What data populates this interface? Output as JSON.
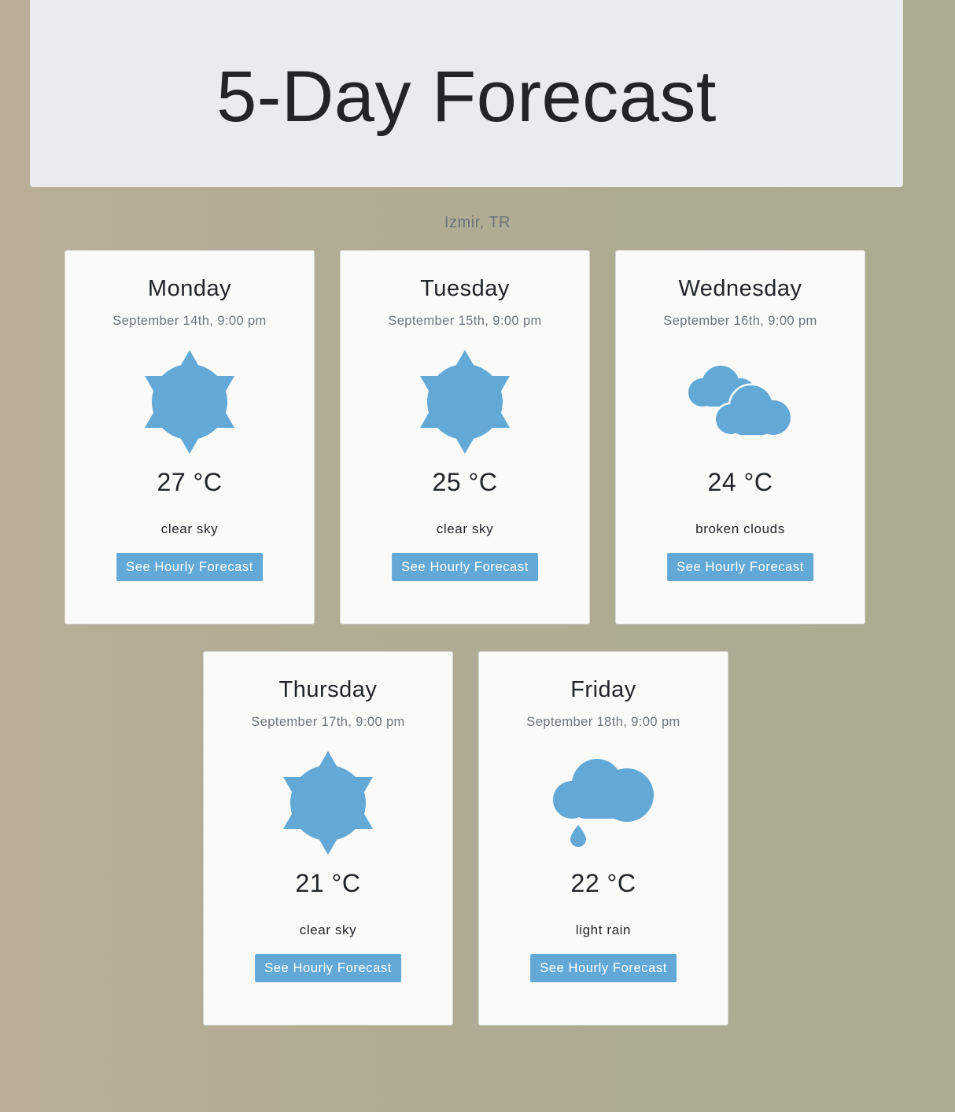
{
  "header": {
    "title": "5-Day Forecast"
  },
  "location": "Izmir, TR",
  "colors": {
    "accent": "#63a9d7",
    "jumbotron_bg": "#e9ebef",
    "card_bg": "#fafaf8"
  },
  "days": [
    {
      "day": "Monday",
      "date": "September 14th, 9:00 pm",
      "icon": "sun-icon",
      "temp": "27 °C",
      "description": "clear sky",
      "button_label": "See Hourly Forecast"
    },
    {
      "day": "Tuesday",
      "date": "September 15th, 9:00 pm",
      "icon": "sun-icon",
      "temp": "25 °C",
      "description": "clear sky",
      "button_label": "See Hourly Forecast"
    },
    {
      "day": "Wednesday",
      "date": "September 16th, 9:00 pm",
      "icon": "cloudy-icon",
      "temp": "24 °C",
      "description": "broken clouds",
      "button_label": "See Hourly Forecast"
    },
    {
      "day": "Thursday",
      "date": "September 17th, 9:00 pm",
      "icon": "sun-icon",
      "temp": "21 °C",
      "description": "clear sky",
      "button_label": "See Hourly Forecast"
    },
    {
      "day": "Friday",
      "date": "September 18th, 9:00 pm",
      "icon": "rain-icon",
      "temp": "22 °C",
      "description": "light rain",
      "button_label": "See Hourly Forecast"
    }
  ]
}
